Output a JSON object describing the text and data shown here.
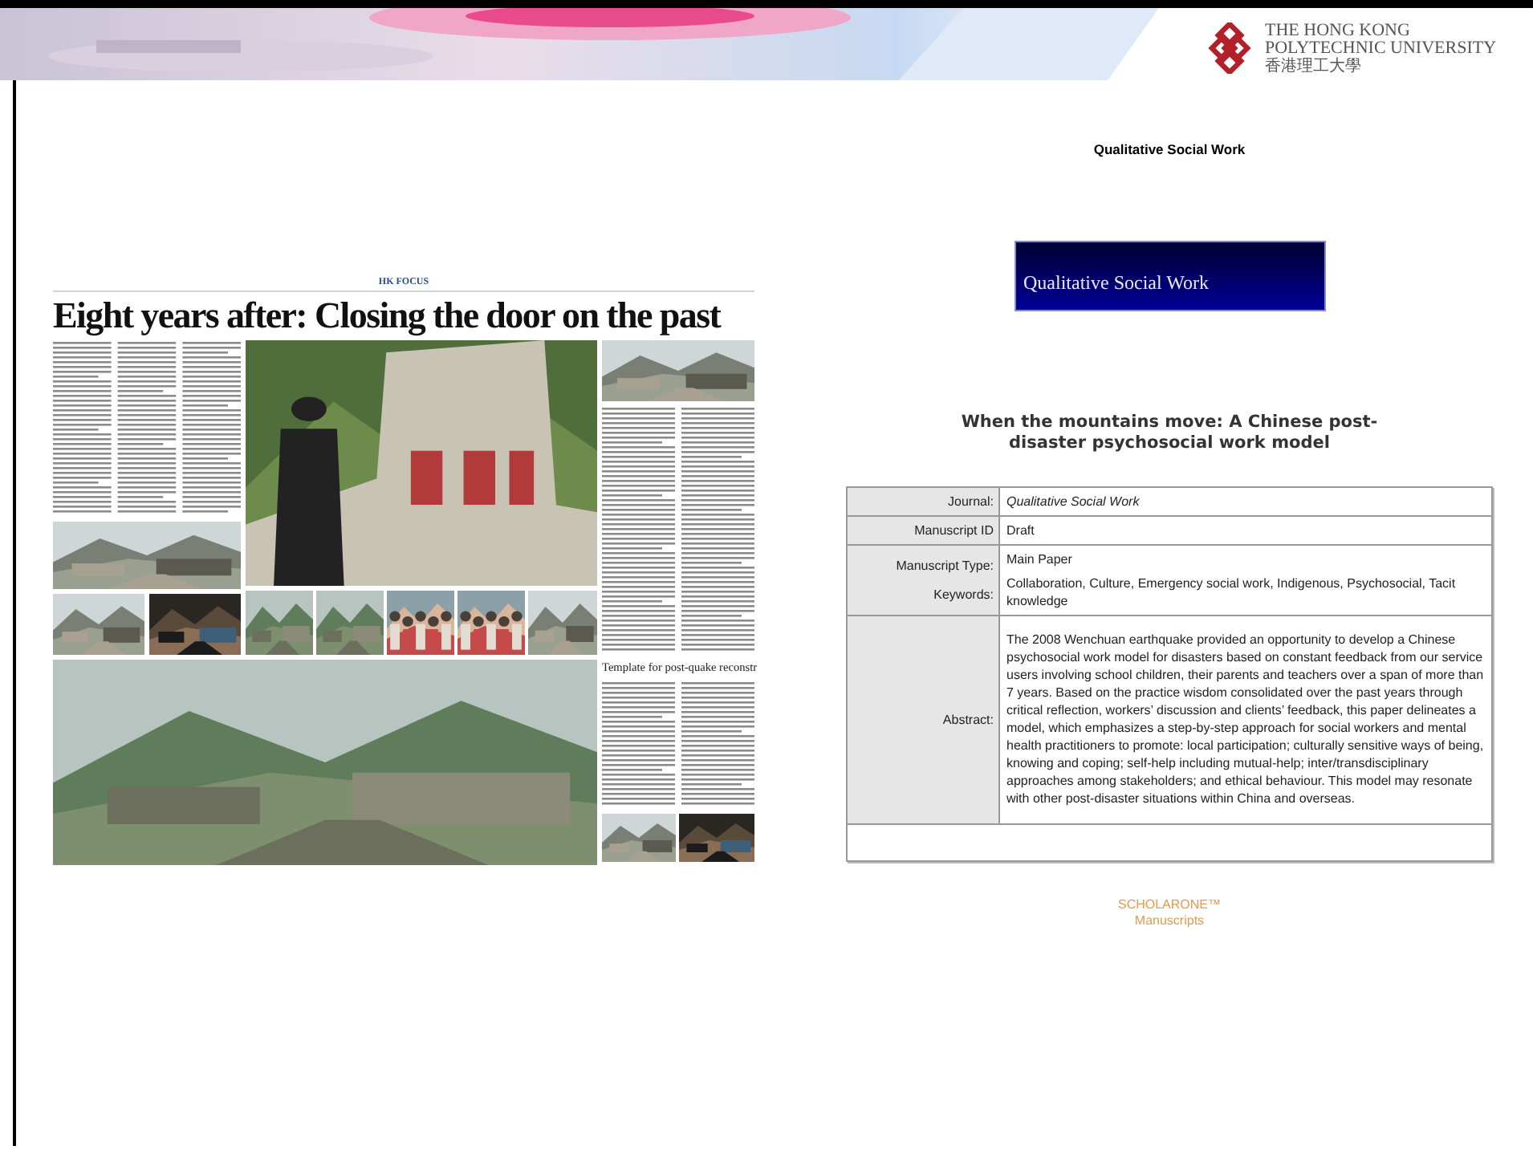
{
  "header": {
    "logo": {
      "lines": [
        "THE HONG KONG",
        "POLYTECHNIC UNIVERSITY"
      ],
      "chinese": "香港理工大學"
    }
  },
  "newspaper": {
    "section": "HK FOCUS",
    "headline": "Eight years after: Closing the door on the past",
    "subheadline": "Template for post-quake reconstr"
  },
  "manuscript": {
    "journal_header": "Qualitative Social Work",
    "journal_banner": "Qualitative Social Work",
    "title": "When the mountains move: A Chinese post-disaster psychosocial work model",
    "rows": [
      {
        "fields": [
          {
            "label": "Journal:",
            "value": "Qualitative Social Work",
            "italic": true
          }
        ]
      },
      {
        "fields": [
          {
            "label": "Manuscript ID",
            "value": "Draft",
            "italic": false
          }
        ]
      },
      {
        "fields": [
          {
            "label": "Manuscript Type:",
            "value": "Main Paper",
            "italic": false
          },
          {
            "label": "Keywords:",
            "value": "Collaboration, Culture, Emergency social work, Indigenous, Psychosocial, Tacit knowledge",
            "italic": false
          }
        ]
      },
      {
        "fields": [
          {
            "label": "Abstract:",
            "value": "The 2008 Wenchuan earthquake provided an opportunity to develop a Chinese psychosocial work model for disasters based on constant feedback from our service users involving school children, their parents and teachers over a span of more than 7 years. Based on the practice wisdom consolidated over the past years through critical reflection, workers’ discussion and clients’ feedback, this paper delineates a model, which emphasizes a step-by-step approach for social workers and mental health practitioners to promote: local participation; culturally sensitive ways of being, knowing and coping; self-help including mutual-help; inter/transdisciplinary approaches among stakeholders; and ethical behaviour. This model may resonate with other post-disaster situations within China and overseas.",
            "italic": false
          }
        ]
      },
      {
        "fields": []
      }
    ],
    "footer": {
      "brand": "SCHOLARONE™",
      "product": "Manuscripts"
    }
  }
}
